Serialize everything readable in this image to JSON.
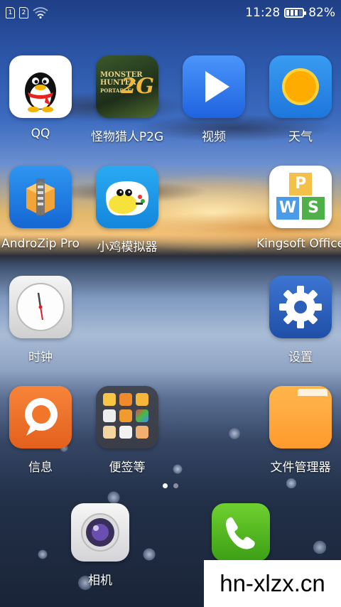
{
  "status_bar": {
    "sim1": "1",
    "sim2": "2",
    "time": "11:28",
    "battery_percent": "82%",
    "battery_level": 0.82
  },
  "apps": [
    {
      "label": "QQ"
    },
    {
      "label": "怪物猎人P2G"
    },
    {
      "label": "视频"
    },
    {
      "label": "天气"
    },
    {
      "label": "AndroZip Pro"
    },
    {
      "label": "小鸡模拟器"
    },
    {
      "label": "Kingsoft Office"
    },
    {
      "label": "时钟"
    },
    {
      "label": "设置"
    },
    {
      "label": "信息"
    },
    {
      "label": "便签等"
    },
    {
      "label": "文件管理器"
    }
  ],
  "dock": [
    {
      "label": "相机"
    },
    {
      "label": ""
    }
  ],
  "game_icon_text": [
    "MONSTER",
    "HUNTER",
    "PORTABLE",
    "2G"
  ],
  "office_letters": [
    "P",
    "W",
    "S"
  ],
  "pages": {
    "count": 2,
    "current": 1
  },
  "watermark": "hn-xlzx.cn",
  "colors": {
    "qq_bg": "#ffffff",
    "video_blue": "#2f7df0",
    "weather_blue": "#2a8ae8",
    "weather_sun": "#ffb400",
    "androzip_blue": "#1d7fe4",
    "chicken_blue": "#1aa0f0",
    "settings_blue": "#2b5fb8",
    "messages_orange": "#f2762a",
    "folder_gray": "#4a4d55",
    "file_orange": "#ffa53a",
    "phone_green": "#49b51f"
  }
}
